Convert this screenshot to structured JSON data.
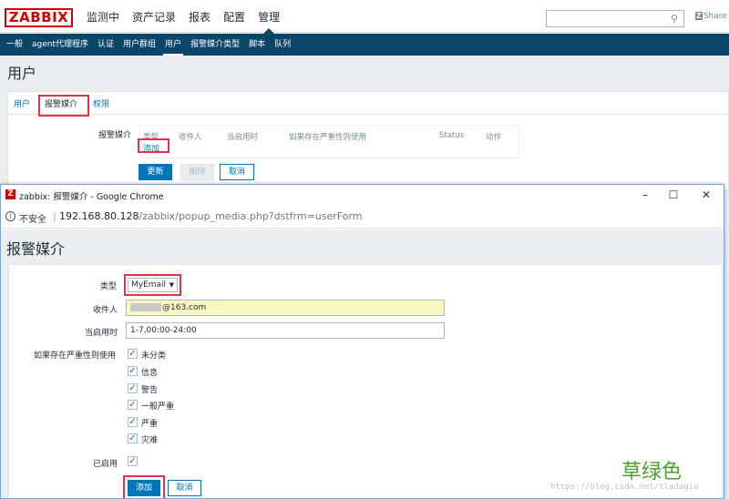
{
  "app": {
    "logo": "ZABBIX",
    "main_menu": [
      "监测中",
      "资产记录",
      "报表",
      "配置",
      "管理"
    ],
    "share": "Share",
    "share_badge": "Z"
  },
  "sub_menu": [
    "一般",
    "agent代理程序",
    "认证",
    "用户群组",
    "用户",
    "报警媒介类型",
    "脚本",
    "队列"
  ],
  "page": {
    "title": "用户",
    "tabs": [
      "用户",
      "报警媒介",
      "权限"
    ],
    "media_label": "报警媒介",
    "media_columns": [
      "类型",
      "收件人",
      "当启用时",
      "如果存在严重性则使用",
      "Status",
      "动作"
    ],
    "add_link": "添加",
    "buttons": {
      "update": "更新",
      "delete": "删除",
      "cancel": "取消"
    }
  },
  "popup": {
    "window_title": "zabbix: 报警媒介 - Google Chrome",
    "window_icon": "Z",
    "insecure": "不安全",
    "url_host": "192.168.80.128",
    "url_path": "/zabbix/popup_media.php?dstfrm=userForm",
    "title": "报警媒介",
    "form": {
      "type_label": "类型",
      "type_value": "MyEmail",
      "sendto_label": "收件人",
      "sendto_value": "@163.com",
      "period_label": "当启用时",
      "period_value": "1-7,00:00-24:00",
      "severity_label": "如果存在严重性则使用",
      "severities": [
        "未分类",
        "信息",
        "警告",
        "一般严重",
        "严重",
        "灾难"
      ],
      "enabled_label": "已启用",
      "add_button": "添加",
      "cancel_button": "取消"
    }
  },
  "watermark": {
    "text": "草绿色",
    "url": "https://blog.csdn.net/tladagio"
  },
  "colors": {
    "brand_red": "#d40000",
    "nav_blue": "#0a466a",
    "link_blue": "#0275b8",
    "highlight_red": "#e0324b",
    "autofill_yellow": "#fbf7c1",
    "watermark_green": "#4aa02c"
  }
}
